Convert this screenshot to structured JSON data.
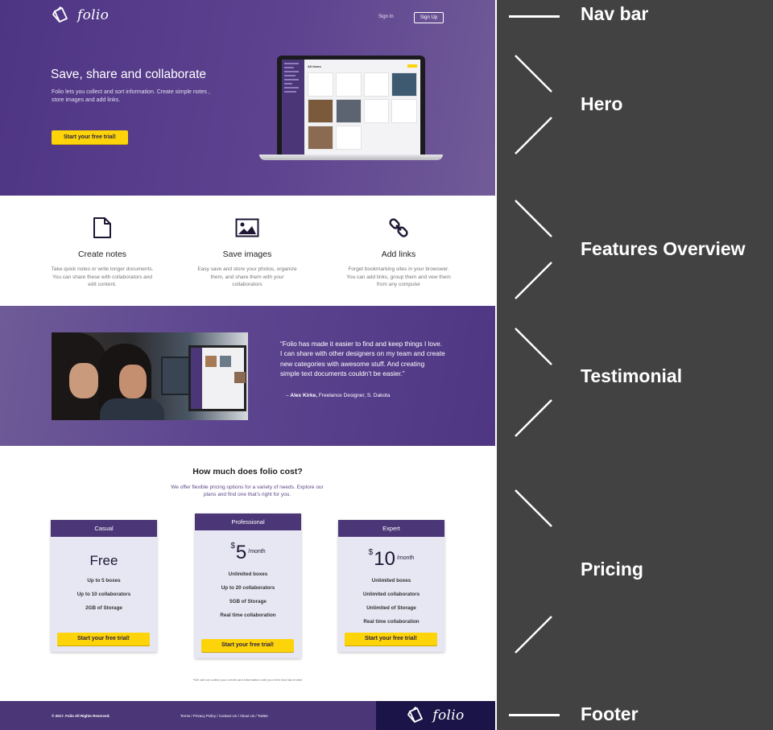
{
  "nav": {
    "logo": "folio",
    "sign_in": "Sign In",
    "sign_up": "Sign Up"
  },
  "hero": {
    "title": "Save, share and collaborate",
    "subtitle": "Folio lets you collect and sort information. Create simple notes , store images and add links.",
    "cta": "Start your free trial!",
    "mockup_header": "All items"
  },
  "features": [
    {
      "icon": "document-icon",
      "title": "Create notes",
      "text": "Take quick notes or write longer documents. You can share these with collaborators and edit content."
    },
    {
      "icon": "image-icon",
      "title": "Save images",
      "text": "Easy save and store your photos, organize them, and share them with your collaborators"
    },
    {
      "icon": "link-icon",
      "title": "Add links",
      "text": "Forget bookmarking sites in your browswer. You can add links, group them and vew them from any computer"
    }
  ],
  "testimonial": {
    "quote": "“Folio has made it easier to find and keep things I love. I can share with other designers on my team and create new categories with awesome stuff. And creating simple text documents couldn’t be easier.”",
    "dash": "– ",
    "author": "Alex Kirke,",
    "role": " Freelance Designer, S. Dakota"
  },
  "pricing": {
    "title": "How much does folio cost?",
    "subtitle": "We offer flexible pricing options for a variety of needs. Explore our plans and find one that’s right for you.",
    "plans": [
      {
        "name": "Casual",
        "price": "Free",
        "features": [
          "Up to 5 boxes",
          "Up to 10 collaborators",
          "2GB of Storage"
        ],
        "cta": "Start your free trial!"
      },
      {
        "name": "Professional",
        "currency": "$",
        "price": "5",
        "period": "/month",
        "features": [
          "Unlimited boxes",
          "Up to 20 collaborators",
          "5GB of Storage",
          "Real time collaboration"
        ],
        "cta": "Start your free trial!"
      },
      {
        "name": "Expert",
        "currency": "$",
        "price": "10",
        "period": "/month",
        "features": [
          "Unlimited boxes",
          "Unlimited collaborators",
          "Unlimited of Storage",
          "Real time collaboration"
        ],
        "cta": "Start your free trial!"
      }
    ],
    "note": "*We will not collect your credit card information until your free trial has ended"
  },
  "footer": {
    "copyright": "© 2017. Folio All Rights Reserved.",
    "links": [
      "Terms",
      "Privacy Policy",
      "Contact Us",
      "About Us",
      "Twitter"
    ],
    "separator": " / ",
    "brand": "folio"
  },
  "annotations": [
    "Nav bar",
    "Hero",
    "Features Overview",
    "Testimonial",
    "Pricing",
    "Footer"
  ],
  "colors": {
    "brand_purple": "#4b3677",
    "cta_yellow": "#fdd40a",
    "footer_dark": "#1b1448",
    "annotation_bg": "#424242"
  }
}
